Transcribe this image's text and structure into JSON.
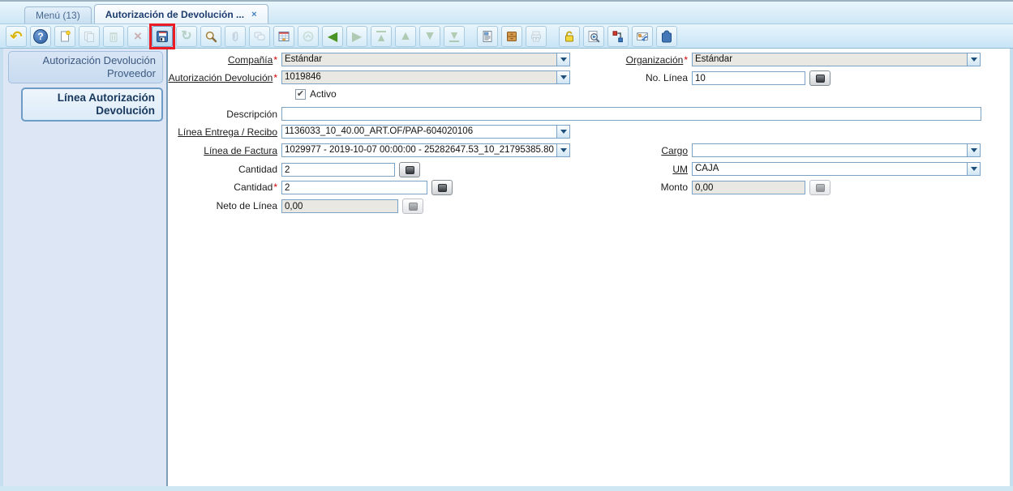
{
  "icons": {
    "close": "×",
    "undo": "↶",
    "refresh": "↻",
    "check": "✔",
    "question": "?",
    "arrow_left": "◀",
    "arrow_right": "▶",
    "arrow_up": "▲",
    "arrow_down": "▼"
  },
  "window": {
    "tabs": [
      {
        "label": "Menú (13)"
      },
      {
        "label": "Autorización de Devolución ..."
      }
    ]
  },
  "toolbar": {
    "buttons": [
      "undo",
      "help",
      "new-record",
      "copy-record",
      "delete-record",
      "delete-selection",
      "save",
      "refresh",
      "find-record",
      "attachment",
      "chat",
      "grid-toggle",
      "history",
      "parent-record",
      "detail-record",
      "first-record",
      "previous-record",
      "next-record",
      "last-record",
      "report",
      "archive",
      "print",
      "record-lock",
      "zoom-across",
      "workflow",
      "check-requests",
      "product-info"
    ]
  },
  "sidebar": {
    "tabs": [
      {
        "label": "Autorización Devolución Proveedor"
      },
      {
        "label": "Línea Autorización Devolución"
      }
    ]
  },
  "form": {
    "required_marker": "*",
    "compania": {
      "label": "Compañía",
      "value": "Estándar"
    },
    "organizacion": {
      "label": "Organización",
      "value": "Estándar"
    },
    "autorizacion_devolucion": {
      "label": "Autorización Devolución",
      "value": "1019846"
    },
    "no_linea": {
      "label": "No. Línea",
      "value": "10"
    },
    "activo": {
      "label": "Activo",
      "checked": true
    },
    "descripcion": {
      "label": "Descripción",
      "value": ""
    },
    "linea_entrega": {
      "label": "Línea Entrega / Recibo",
      "value": "1136033_10_40.00_ART.OF/PAP-604020106"
    },
    "linea_factura": {
      "label": "Línea de Factura",
      "value": "1029977 - 2019-10-07 00:00:00 - 25282647.53_10_21795385.80"
    },
    "cargo": {
      "label": "Cargo",
      "value": ""
    },
    "cantidad": {
      "label": "Cantidad",
      "value": "2"
    },
    "um": {
      "label": "UM",
      "value": "CAJA"
    },
    "cantidad_requerida": {
      "label": "Cantidad",
      "value": "2"
    },
    "monto": {
      "label": "Monto",
      "value": "0,00"
    },
    "neto_linea": {
      "label": "Neto de Línea",
      "value": "0,00"
    }
  }
}
